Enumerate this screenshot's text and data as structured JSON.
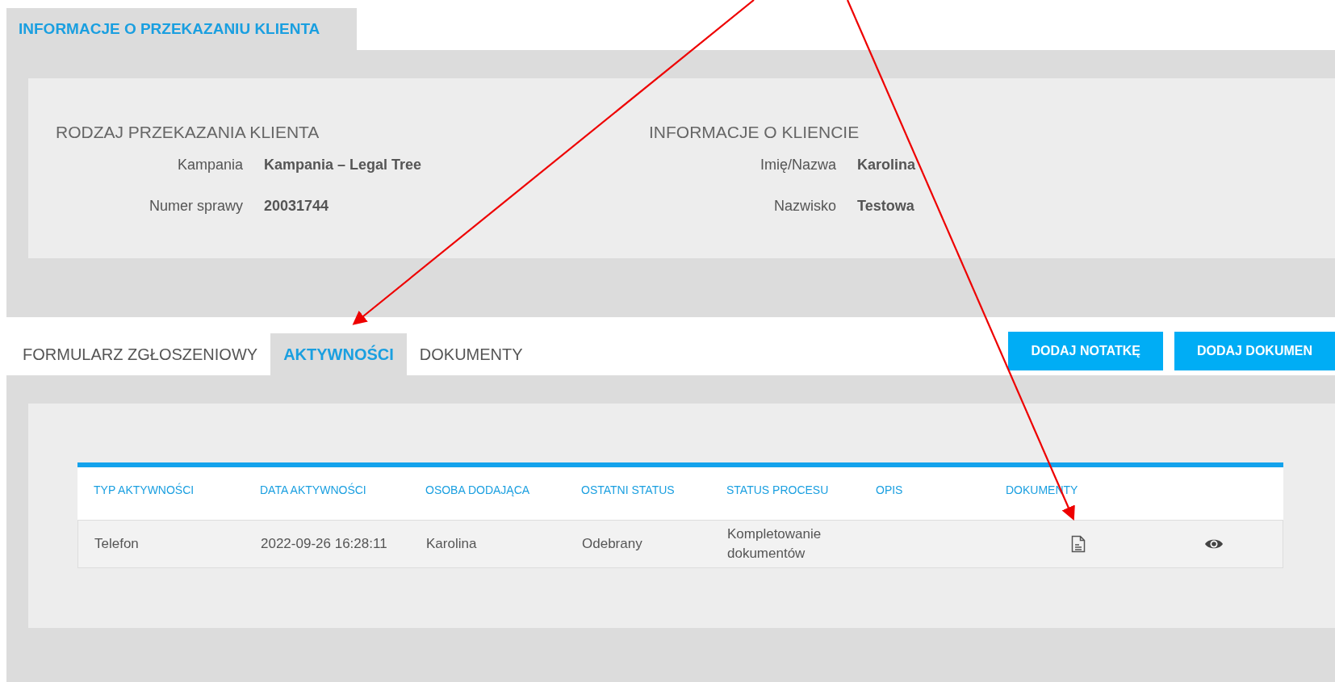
{
  "header_tab": {
    "label": "INFORMACJE O PRZEKAZANIU KLIENTA"
  },
  "info_sections": [
    {
      "title": "RODZAJ PRZEKAZANIA KLIENTA",
      "fields": [
        {
          "label": "Kampania",
          "value": "Kampania – Legal Tree"
        },
        {
          "label": "Numer sprawy",
          "value": "20031744"
        }
      ]
    },
    {
      "title": "INFORMACJE O KLIENCIE",
      "fields": [
        {
          "label": "Imię/Nazwa",
          "value": "Karolina"
        },
        {
          "label": "Nazwisko",
          "value": "Testowa"
        }
      ]
    }
  ],
  "tabs": [
    {
      "label": "FORMULARZ ZGŁOSZENIOWY",
      "selected": false
    },
    {
      "label": "AKTYWNOŚCI",
      "selected": true
    },
    {
      "label": "DOKUMENTY",
      "selected": false
    }
  ],
  "buttons": [
    "DODAJ NOTATKĘ",
    "DODAJ DOKUMEN"
  ],
  "table": {
    "columns": [
      "TYP AKTYWNOŚCI",
      "DATA AKTYWNOŚCI",
      "OSOBA DODAJĄCA",
      "OSTATNI STATUS",
      "STATUS PROCESU",
      "OPIS",
      "DOKUMENTY"
    ],
    "rows": [
      {
        "cells": [
          "Telefon",
          "2022-09-26 16:28:11",
          "Karolina",
          "Odebrany",
          "Kompletowanie dokumentów",
          null
        ]
      }
    ]
  }
}
